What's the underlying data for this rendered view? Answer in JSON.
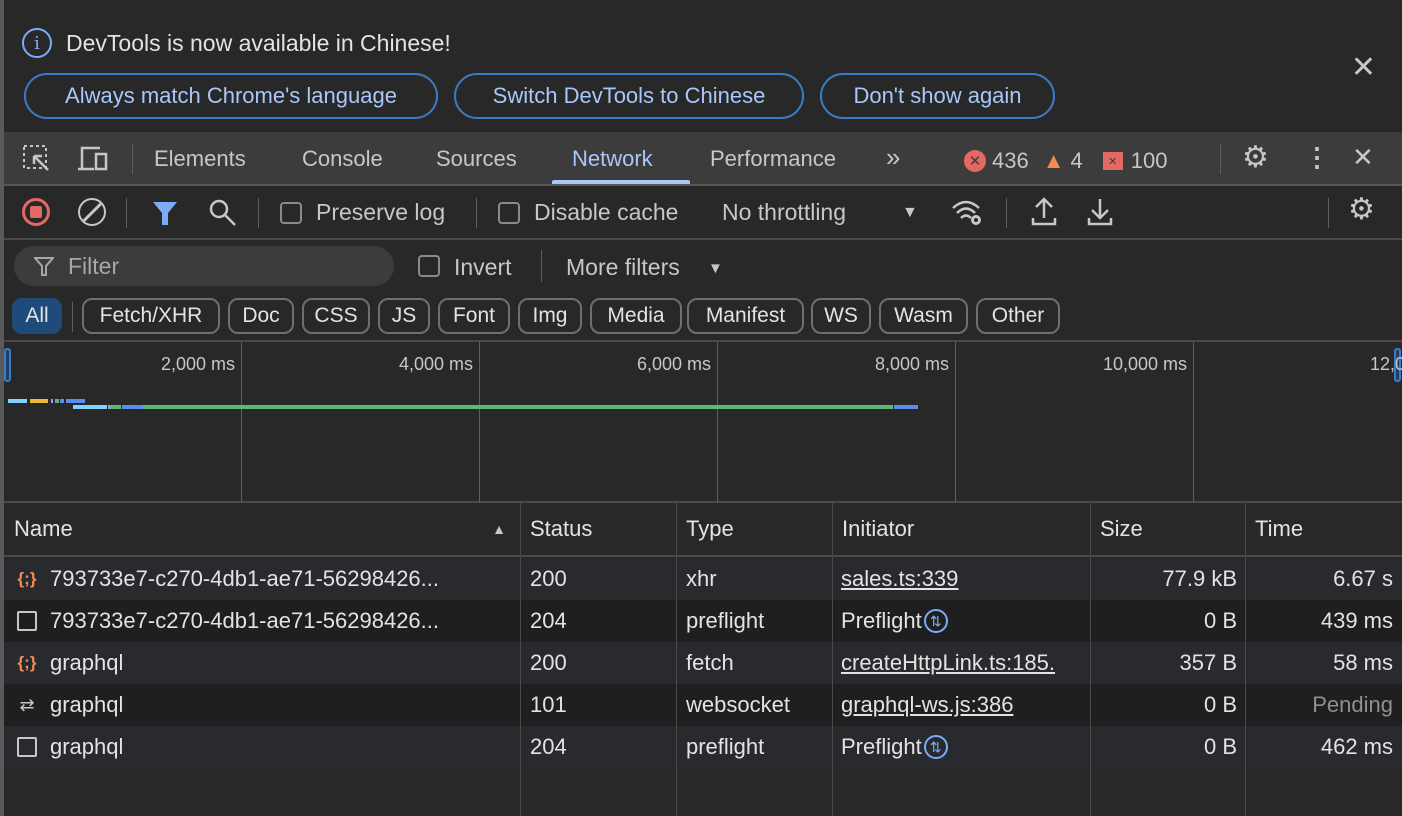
{
  "infobar": {
    "message": "DevTools is now available in Chinese!",
    "buttons": [
      "Always match Chrome's language",
      "Switch DevTools to Chinese",
      "Don't show again"
    ]
  },
  "tabs": {
    "items": [
      "Elements",
      "Console",
      "Sources",
      "Network",
      "Performance"
    ],
    "active": "Network",
    "more": "»",
    "errors": "436",
    "warnings": "4",
    "issues": "100"
  },
  "toolbar": {
    "preserve_log": "Preserve log",
    "preserve_log_checked": false,
    "disable_cache": "Disable cache",
    "disable_cache_checked": false,
    "throttling": "No throttling"
  },
  "filter": {
    "placeholder": "Filter",
    "invert": "Invert",
    "invert_checked": false,
    "more_filters": "More filters"
  },
  "types": {
    "items": [
      "All",
      "Fetch/XHR",
      "Doc",
      "CSS",
      "JS",
      "Font",
      "Img",
      "Media",
      "Manifest",
      "WS",
      "Wasm",
      "Other"
    ],
    "active": "All"
  },
  "overview": {
    "ticks": [
      "2,000 ms",
      "4,000 ms",
      "6,000 ms",
      "8,000 ms",
      "10,000 ms",
      "12,000"
    ],
    "bars": [
      {
        "row": 0,
        "segments": [
          {
            "start": 40,
            "end": 200,
            "color": "#80d4ff"
          },
          {
            "start": 230,
            "end": 380,
            "color": "#e8b93a"
          },
          {
            "start": 400,
            "end": 420,
            "color": "#c58af9"
          },
          {
            "start": 440,
            "end": 470,
            "color": "#5bb974"
          },
          {
            "start": 480,
            "end": 510,
            "color": "#5b8def"
          },
          {
            "start": 530,
            "end": 690,
            "color": "#5b8def"
          }
        ]
      },
      {
        "row": 1,
        "segments": [
          {
            "start": 590,
            "end": 875,
            "color": "#80d4ff"
          },
          {
            "start": 880,
            "end": 895,
            "color": "#c58af9"
          },
          {
            "start": 900,
            "end": 990,
            "color": "#5bb974"
          },
          {
            "start": 1000,
            "end": 1175,
            "color": "#5b8def"
          },
          {
            "start": 1180,
            "end": 7480,
            "color": "#5bb974"
          },
          {
            "start": 7490,
            "end": 7690,
            "color": "#5b8def"
          }
        ]
      }
    ]
  },
  "table": {
    "columns": [
      "Name",
      "Status",
      "Type",
      "Initiator",
      "Size",
      "Time"
    ],
    "sort": "ascending",
    "rows": [
      {
        "icon": "xhr",
        "name": "793733e7-c270-4db1-ae71-56298426...",
        "status": "200",
        "type": "xhr",
        "initiator": "sales.ts:339",
        "initiator_link": true,
        "size": "77.9 kB",
        "time": "6.67 s"
      },
      {
        "icon": "doc",
        "name": "793733e7-c270-4db1-ae71-56298426...",
        "status": "204",
        "type": "preflight",
        "initiator": "Preflight",
        "initiator_link": false,
        "size": "0 B",
        "time": "439 ms"
      },
      {
        "icon": "xhr",
        "name": "graphql",
        "status": "200",
        "type": "fetch",
        "initiator": "createHttpLink.ts:185.",
        "initiator_link": true,
        "size": "357 B",
        "time": "58 ms"
      },
      {
        "icon": "ws",
        "name": "graphql",
        "status": "101",
        "type": "websocket",
        "initiator": "graphql-ws.js:386",
        "initiator_link": true,
        "size": "0 B",
        "time": "Pending"
      },
      {
        "icon": "doc",
        "name": "graphql",
        "status": "204",
        "type": "preflight",
        "initiator": "Preflight",
        "initiator_link": false,
        "size": "0 B",
        "time": "462 ms"
      }
    ]
  },
  "colors": {
    "accent": "#a8c7fa",
    "error": "#e46962",
    "warning": "#f28b54",
    "pending": "#8f8f8f"
  }
}
